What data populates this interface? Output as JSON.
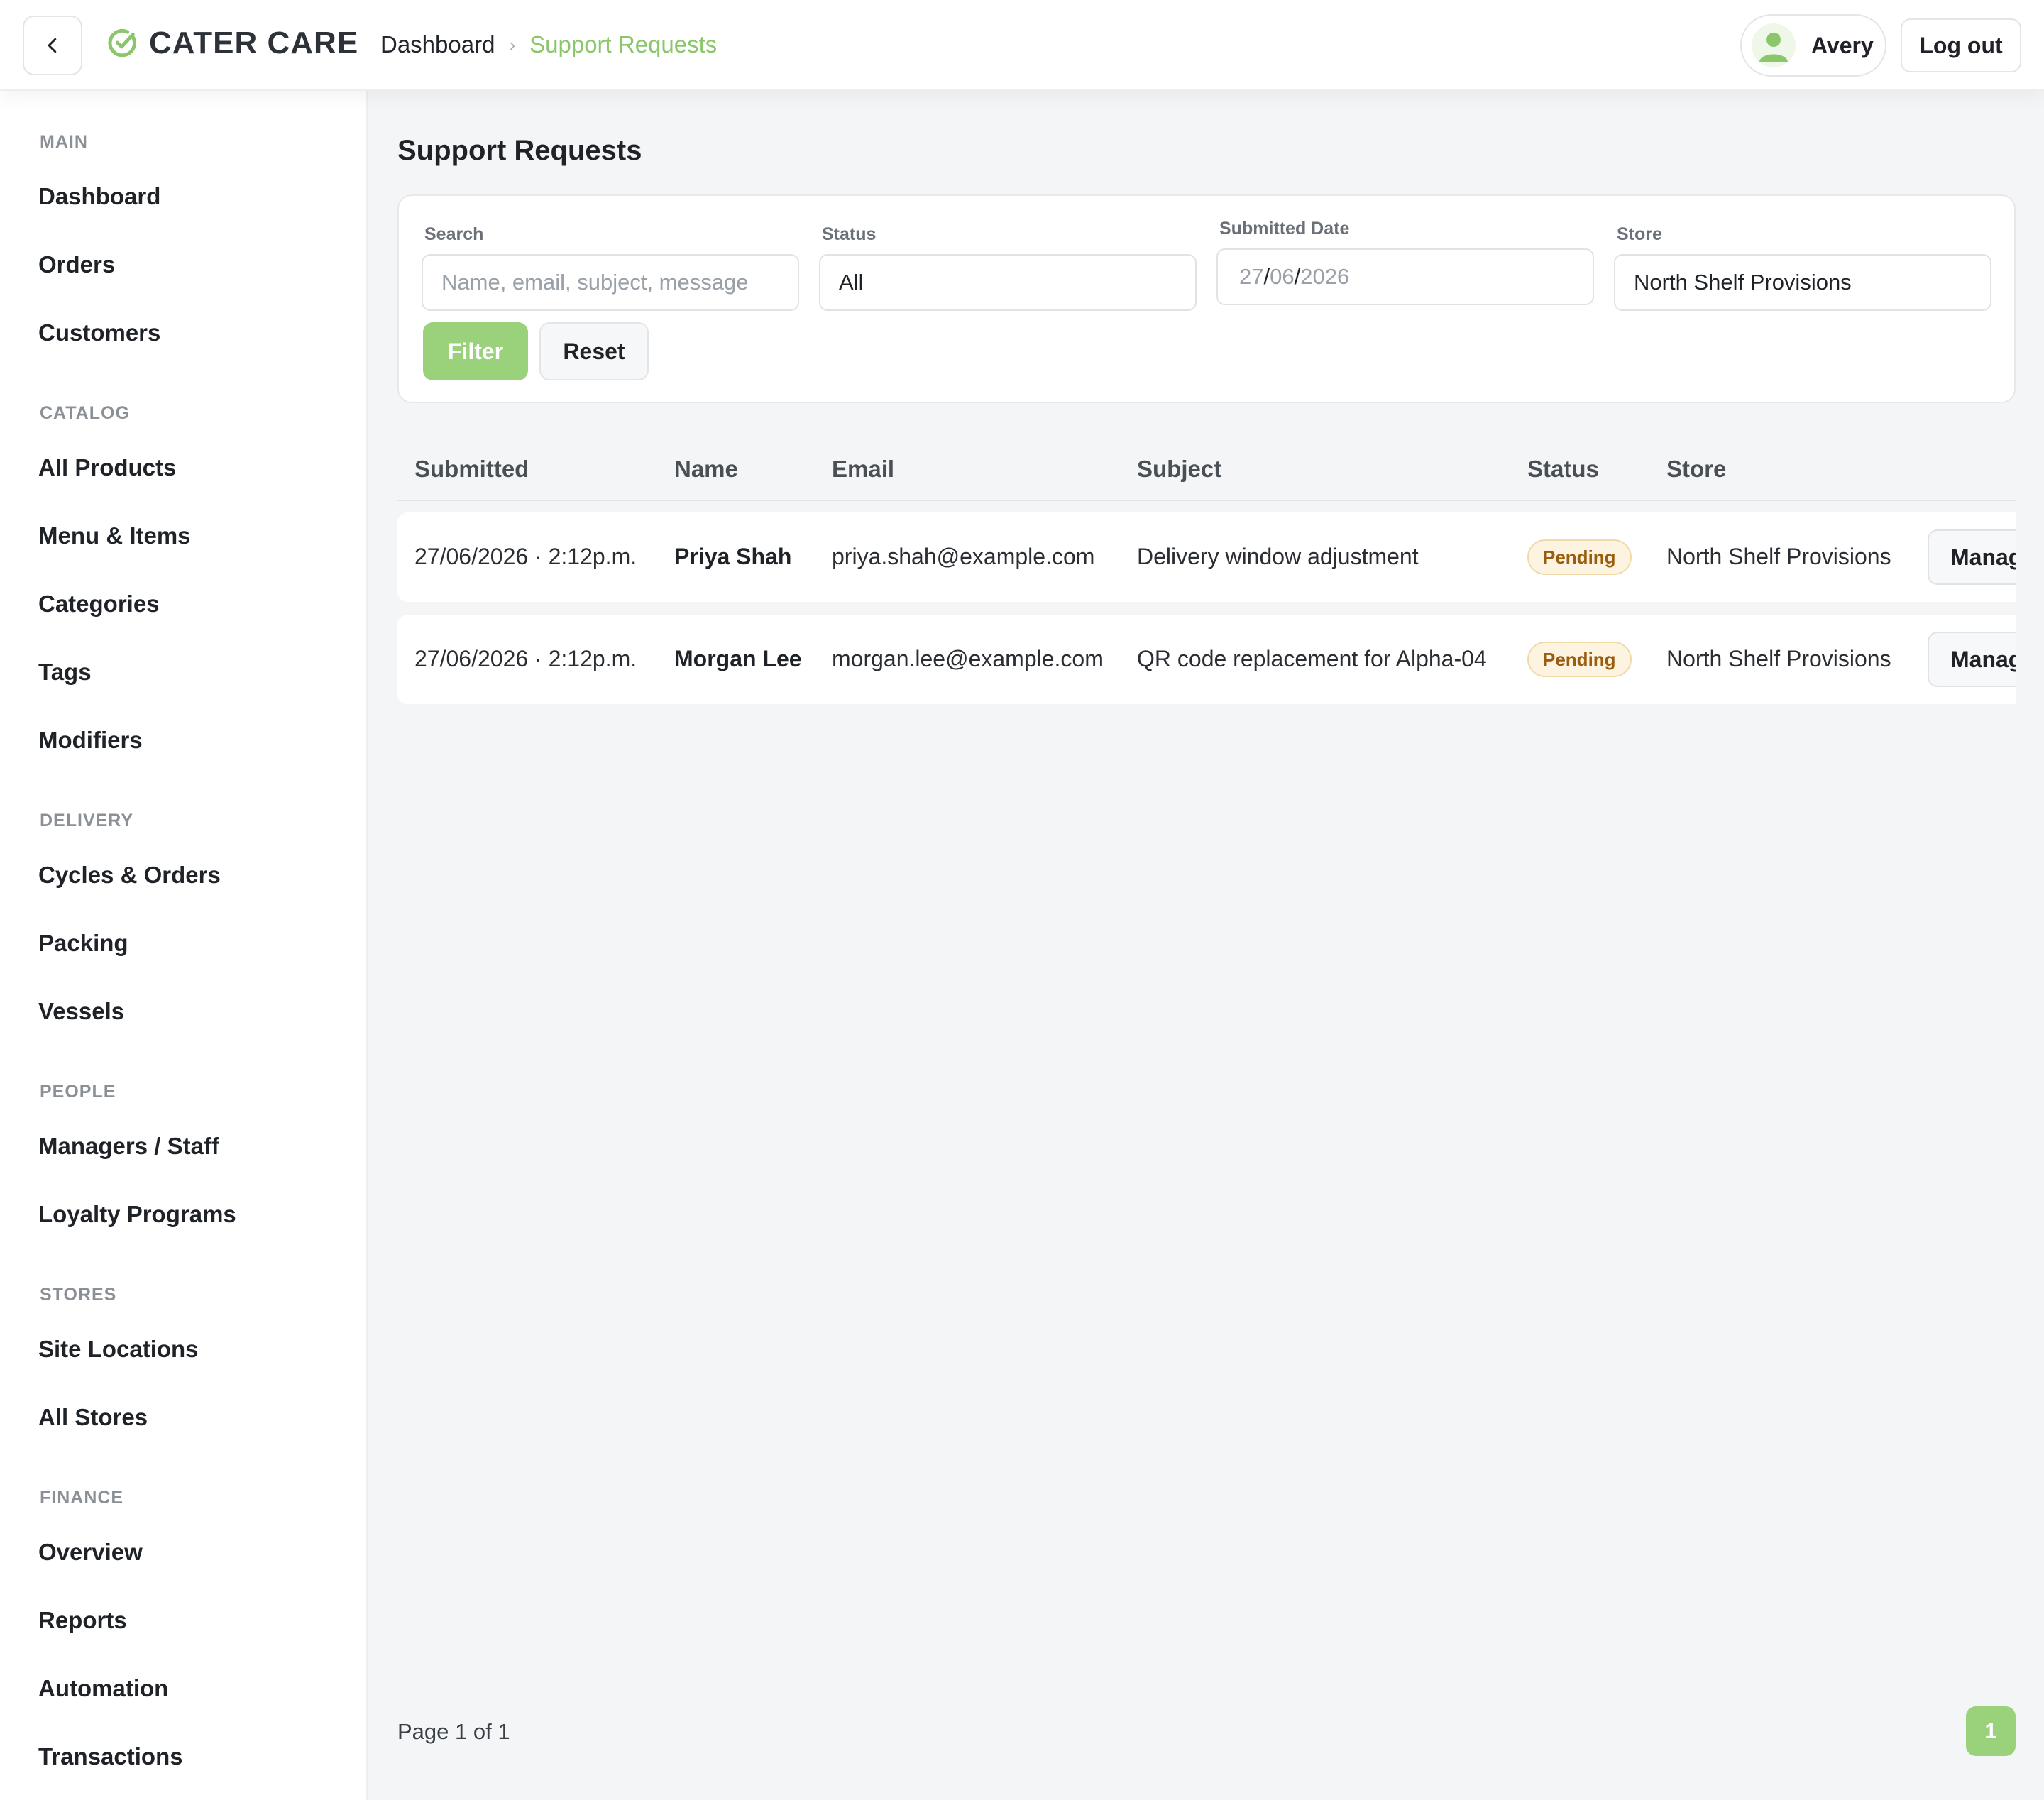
{
  "app": {
    "brand_name": "CATER CARE",
    "brand_color": "#8cc66b"
  },
  "header": {
    "breadcrumb_home": "Dashboard",
    "breadcrumb_sep": "›",
    "breadcrumb_current": "Support Requests",
    "user_name": "Avery",
    "logout_label": "Log out"
  },
  "sidebar": {
    "sections": [
      {
        "title": "MAIN",
        "items": [
          "Dashboard",
          "Orders",
          "Customers"
        ]
      },
      {
        "title": "CATALOG",
        "items": [
          "All Products",
          "Menu & Items",
          "Categories",
          "Tags",
          "Modifiers"
        ]
      },
      {
        "title": "DELIVERY",
        "items": [
          "Cycles & Orders",
          "Packing",
          "Vessels"
        ]
      },
      {
        "title": "PEOPLE",
        "items": [
          "Managers / Staff",
          "Loyalty Programs"
        ]
      },
      {
        "title": "STORES",
        "items": [
          "Site Locations",
          "All Stores"
        ]
      },
      {
        "title": "FINANCE",
        "items": [
          "Overview",
          "Reports",
          "Automation",
          "Transactions"
        ]
      }
    ]
  },
  "main": {
    "title": "Support Requests",
    "filters": {
      "search_label": "Search",
      "search_placeholder": "Name, email, subject, message",
      "status_label": "Status",
      "status_value": "All",
      "date_label": "Submitted Date",
      "date_day": "27",
      "date_month": "06",
      "date_year": "2026",
      "date_sep": "/",
      "store_label": "Store",
      "store_value": "North Shelf Provisions",
      "filter_button": "Filter",
      "reset_button": "Reset"
    },
    "table": {
      "columns": [
        "Submitted",
        "Name",
        "Email",
        "Subject",
        "Status",
        "Store"
      ],
      "rows": [
        {
          "submitted": "27/06/2026 · 2:12p.m.",
          "name": "Priya Shah",
          "email": "priya.shah@example.com",
          "subject": "Delivery window adjustment",
          "status": "Pending",
          "store": "North Shelf Provisions",
          "action": "Manage"
        },
        {
          "submitted": "27/06/2026 · 2:12p.m.",
          "name": "Morgan Lee",
          "email": "morgan.lee@example.com",
          "subject": "QR code replacement for Alpha-04",
          "status": "Pending",
          "store": "North Shelf Provisions",
          "action": "Manage"
        }
      ]
    },
    "pagination": {
      "info": "Page 1 of 1",
      "current_page": "1"
    }
  },
  "icons": {
    "back": "chevron-left-icon",
    "brand": "check-circle-icon",
    "user": "user-avatar-icon"
  }
}
